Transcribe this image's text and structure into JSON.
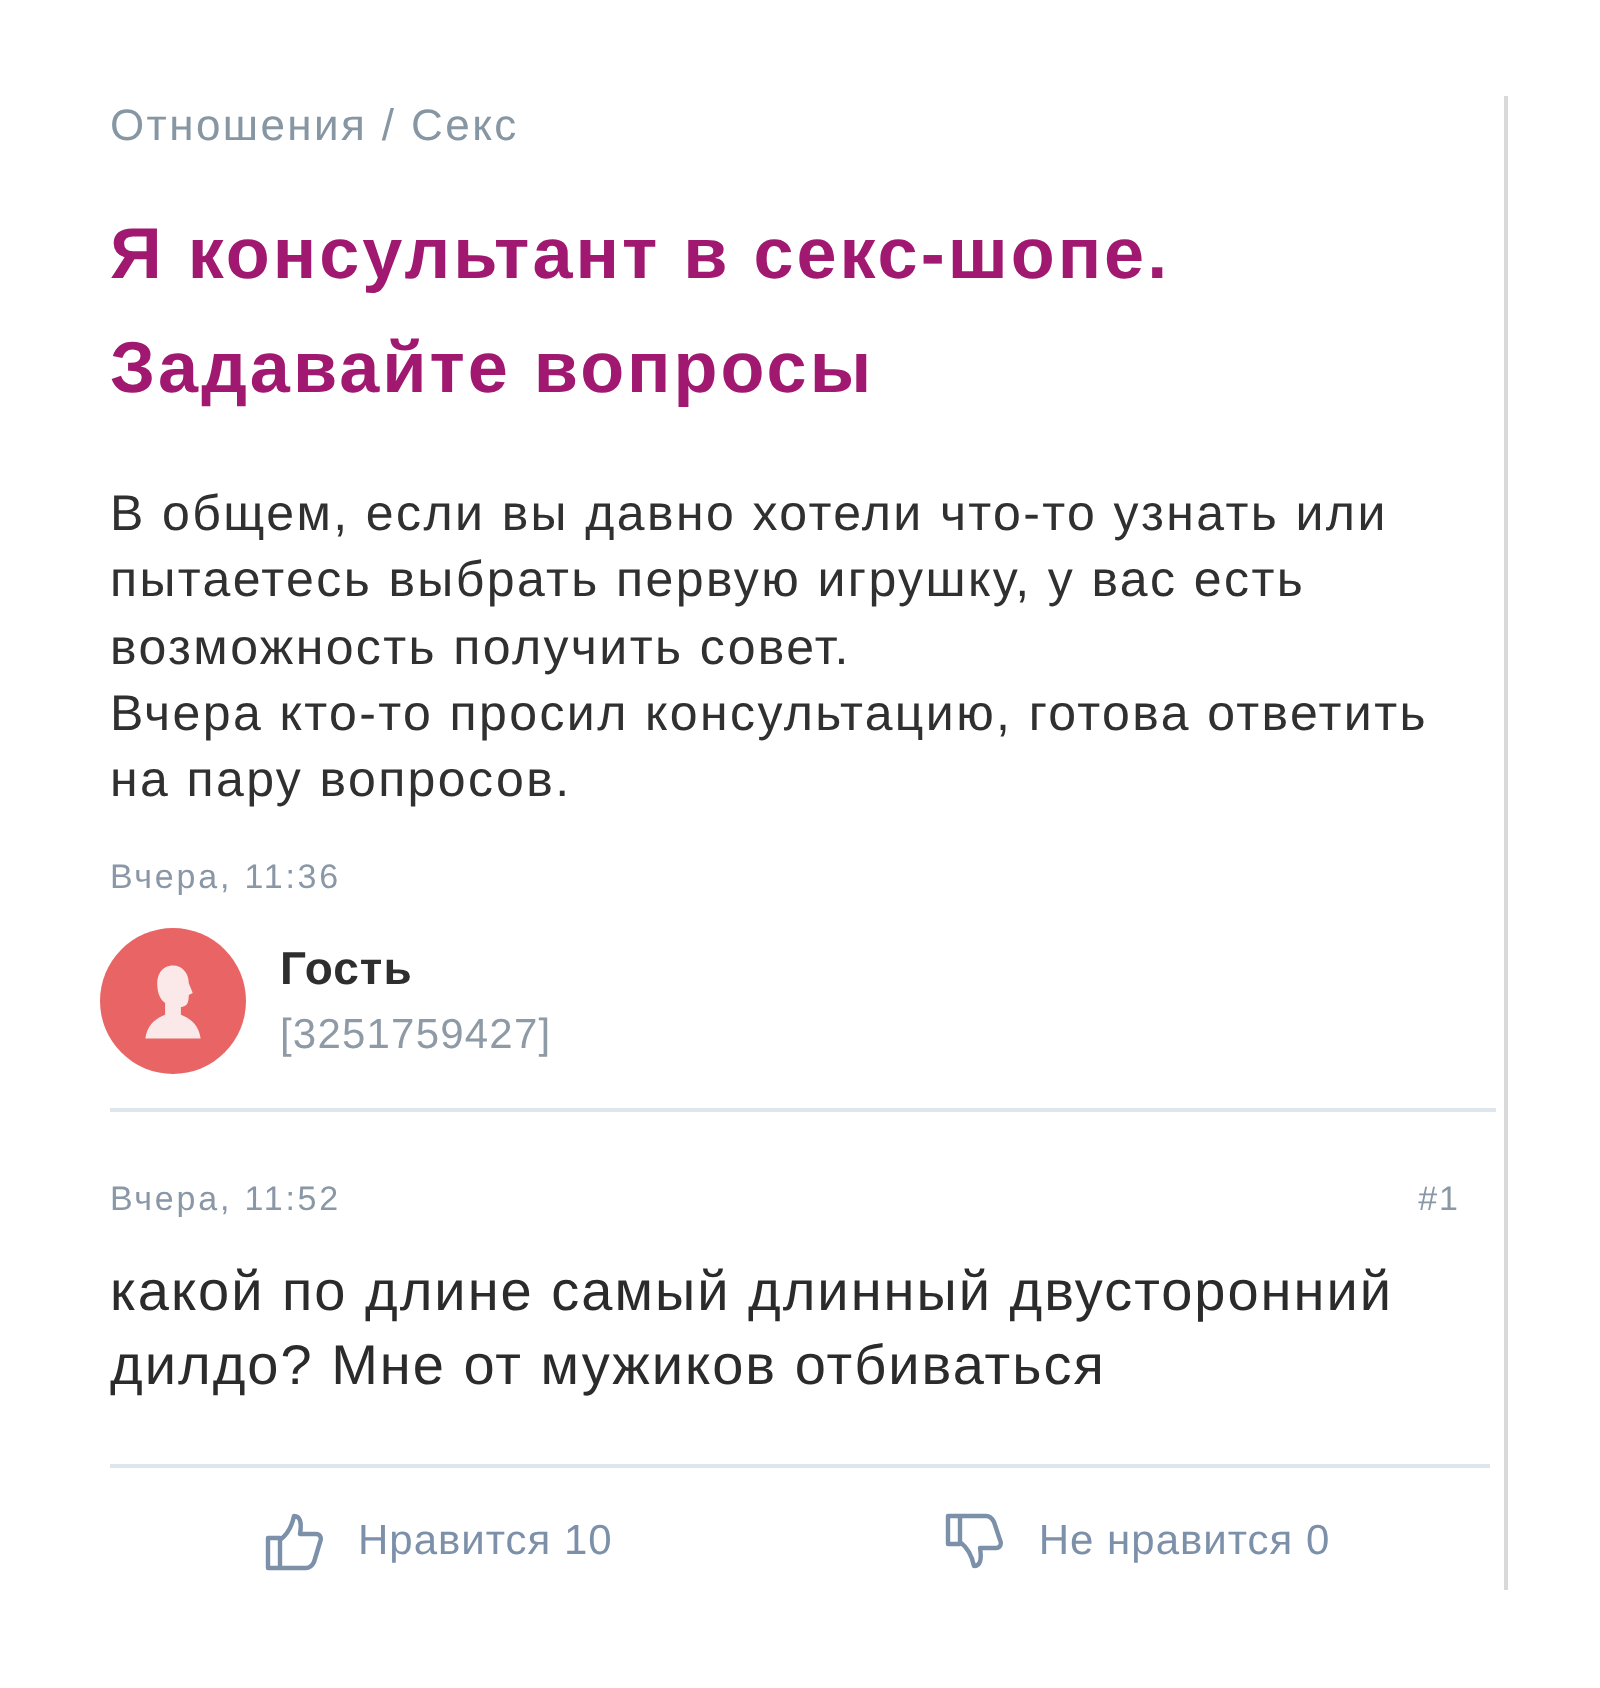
{
  "breadcrumb": "Отношения / Секс",
  "post": {
    "title": "Я консультант в секс-шопе. Задавайте вопросы",
    "paragraphs": [
      "В общем, если вы давно хотели что-то узнать или пытаетесь выбрать первую игрушку, у вас есть возможность получить совет.",
      "Вчера кто-то просил консультацию, готова ответить на пару вопросов."
    ],
    "time": "Вчера, 11:36",
    "author": {
      "name": "Гость",
      "id": "[3251759427]"
    }
  },
  "comments": [
    {
      "time": "Вчера, 11:52",
      "number": "#1",
      "text": "какой по длине самый длинный двусторонний дилдо? Мне от мужиков отбиваться",
      "reactions": [
        {
          "kind": "like",
          "label": "Нравится 10"
        },
        {
          "kind": "dislike",
          "label": "Не нравится 0"
        }
      ]
    }
  ]
}
